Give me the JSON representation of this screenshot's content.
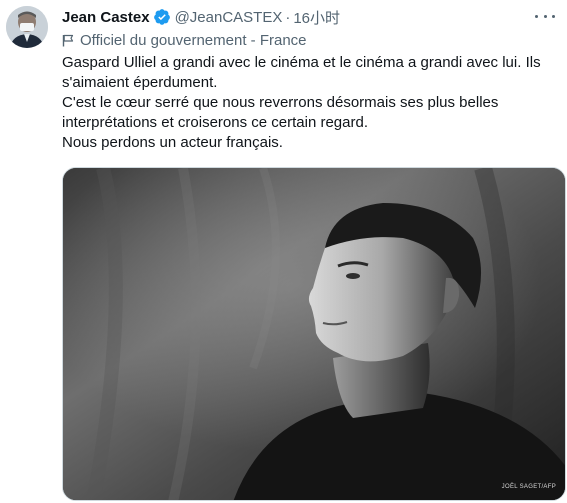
{
  "author": {
    "name": "Jean Castex",
    "handle": "@JeanCASTEX",
    "separator": "·",
    "time": "16小时"
  },
  "label": "Officiel du gouvernement - France",
  "body_lines": [
    "Gaspard Ulliel a grandi avec le cinéma et le cinéma a grandi avec lui. Ils s'aimaient éperdument.",
    "C'est le cœur serré que nous reverrons désormais ses plus belles interprétations et croiserons ce certain regard.",
    "Nous perdons un acteur français."
  ],
  "media": {
    "credit": "JOËL SAGET/AFP"
  },
  "icons": {
    "verified": "verified-badge-icon",
    "label_flag": "government-flag-icon",
    "more": "more-options-icon"
  },
  "colors": {
    "text_primary": "#0f1419",
    "text_secondary": "#536471",
    "verified_blue": "#1d9bf0"
  }
}
